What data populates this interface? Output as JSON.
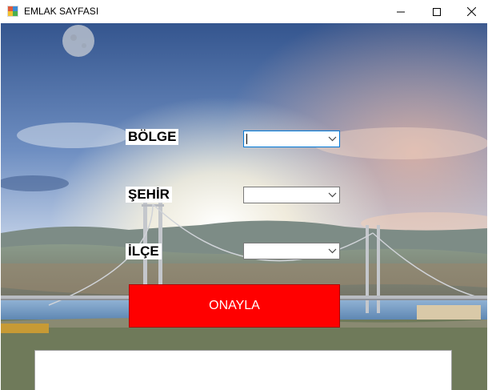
{
  "window": {
    "title": "EMLAK SAYFASI"
  },
  "form": {
    "bolge_label": "BÖLGE",
    "sehir_label": "ŞEHİR",
    "ilce_label": "İLÇE",
    "bolge_value": "",
    "sehir_value": "",
    "ilce_value": "",
    "confirm_label": "ONAYLA",
    "output_text": ""
  },
  "colors": {
    "confirm_button": "#ff0000",
    "sky_top": "#3a5f9a",
    "sky_horizon": "#e8eef5",
    "sea": "#4c7fb0"
  },
  "icons": {
    "app": "app-window-icon",
    "minimize": "minimize-icon",
    "maximize": "maximize-icon",
    "close": "close-icon",
    "dropdown": "chevron-down-icon"
  }
}
